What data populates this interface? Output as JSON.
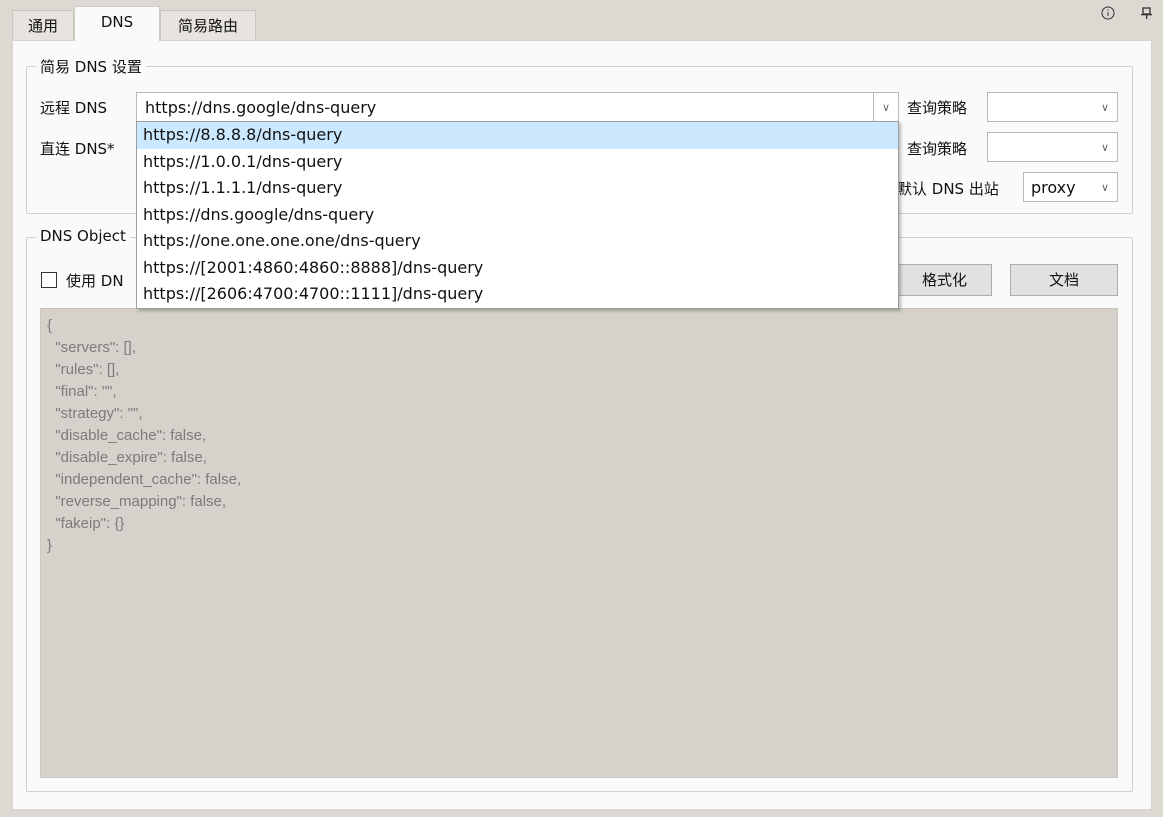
{
  "tabs": [
    "通用",
    "DNS",
    "简易路由"
  ],
  "active_tab": "DNS",
  "top_icons": [
    "info-icon",
    "pin-icon"
  ],
  "simple_dns": {
    "title": "简易 DNS 设置",
    "remote_label": "远程 DNS",
    "remote_value": "https://dns.google/dns-query",
    "direct_label": "直连 DNS*",
    "strategy_label": "查询策略",
    "strategy_label_2": "查询策略",
    "default_outbound_label": "默认 DNS 出站",
    "default_outbound_value": "proxy"
  },
  "dropdown_options": [
    "https://8.8.8.8/dns-query",
    "https://1.0.0.1/dns-query",
    "https://1.1.1.1/dns-query",
    "https://dns.google/dns-query",
    "https://one.one.one.one/dns-query",
    "https://[2001:4860:4860::8888]/dns-query",
    "https://[2606:4700:4700::1111]/dns-query"
  ],
  "dropdown_highlighted_index": 0,
  "dns_object": {
    "title": "DNS Object",
    "checkbox_label": "使用 DN",
    "format_button": "格式化",
    "docs_button": "文档",
    "editor_text": "{\n  \"servers\": [],\n  \"rules\": [],\n  \"final\": \"\",\n  \"strategy\": \"\",\n  \"disable_cache\": false,\n  \"disable_expire\": false,\n  \"independent_cache\": false,\n  \"reverse_mapping\": false,\n  \"fakeip\": {}\n}"
  }
}
